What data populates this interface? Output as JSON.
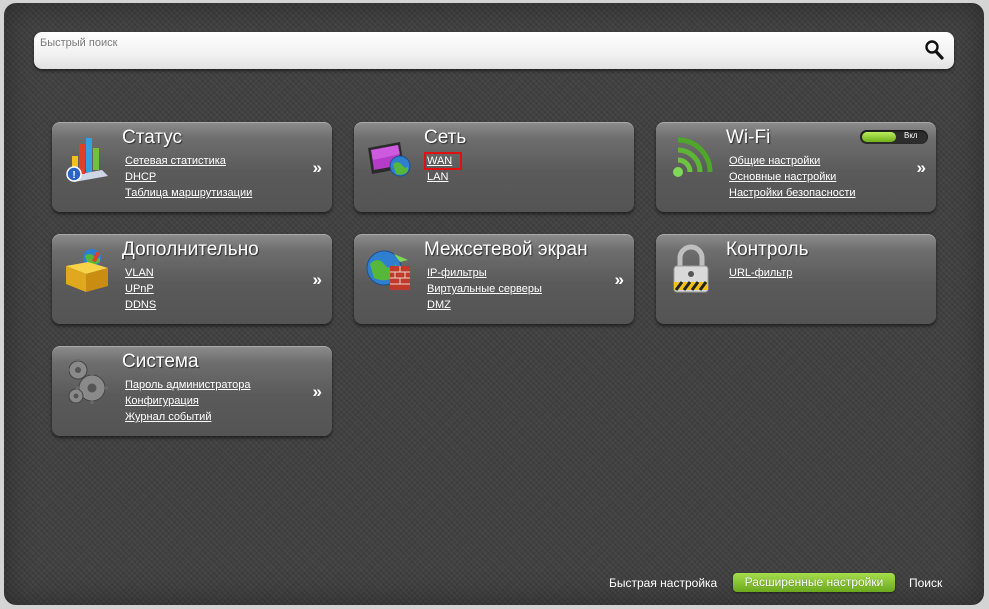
{
  "search": {
    "placeholder": "Быстрый поиск"
  },
  "tiles": {
    "status": {
      "title": "Статус",
      "links": [
        "Сетевая статистика",
        "DHCP",
        "Таблица маршрутизации"
      ],
      "arrow": "»"
    },
    "network": {
      "title": "Сеть",
      "links": [
        "WAN",
        "LAN"
      ],
      "highlighted_link": "WAN",
      "arrow": ""
    },
    "wifi": {
      "title": "Wi-Fi",
      "links": [
        "Общие настройки",
        "Основные настройки",
        "Настройки безопасности"
      ],
      "toggle": {
        "label": "Вкл",
        "state": "on"
      },
      "arrow": "»"
    },
    "advanced": {
      "title": "Дополнительно",
      "links": [
        "VLAN",
        "UPnP",
        "DDNS"
      ],
      "arrow": "»"
    },
    "firewall": {
      "title": "Межсетевой экран",
      "links": [
        "IP-фильтры",
        "Виртуальные серверы",
        "DMZ"
      ],
      "arrow": "»"
    },
    "control": {
      "title": "Контроль",
      "links": [
        "URL-фильтр"
      ],
      "arrow": ""
    },
    "system": {
      "title": "Система",
      "links": [
        "Пароль администратора",
        "Конфигурация",
        "Журнал событий"
      ],
      "arrow": "»"
    }
  },
  "bottom_nav": {
    "quick_setup": "Быстрая настройка",
    "advanced_settings": "Расширенные настройки",
    "search": "Поиск",
    "active": "advanced_settings"
  },
  "colors": {
    "accent_green": "#8cc63f",
    "highlight_red": "#e01010",
    "background": "#3f3f3f"
  },
  "icons": {
    "status": "bar-chart-icon",
    "network": "monitor-globe-icon",
    "wifi": "wifi-icon",
    "advanced": "box-icon",
    "firewall": "globe-firewall-icon",
    "control": "padlock-icon",
    "system": "gears-icon",
    "search": "magnifier-icon"
  }
}
